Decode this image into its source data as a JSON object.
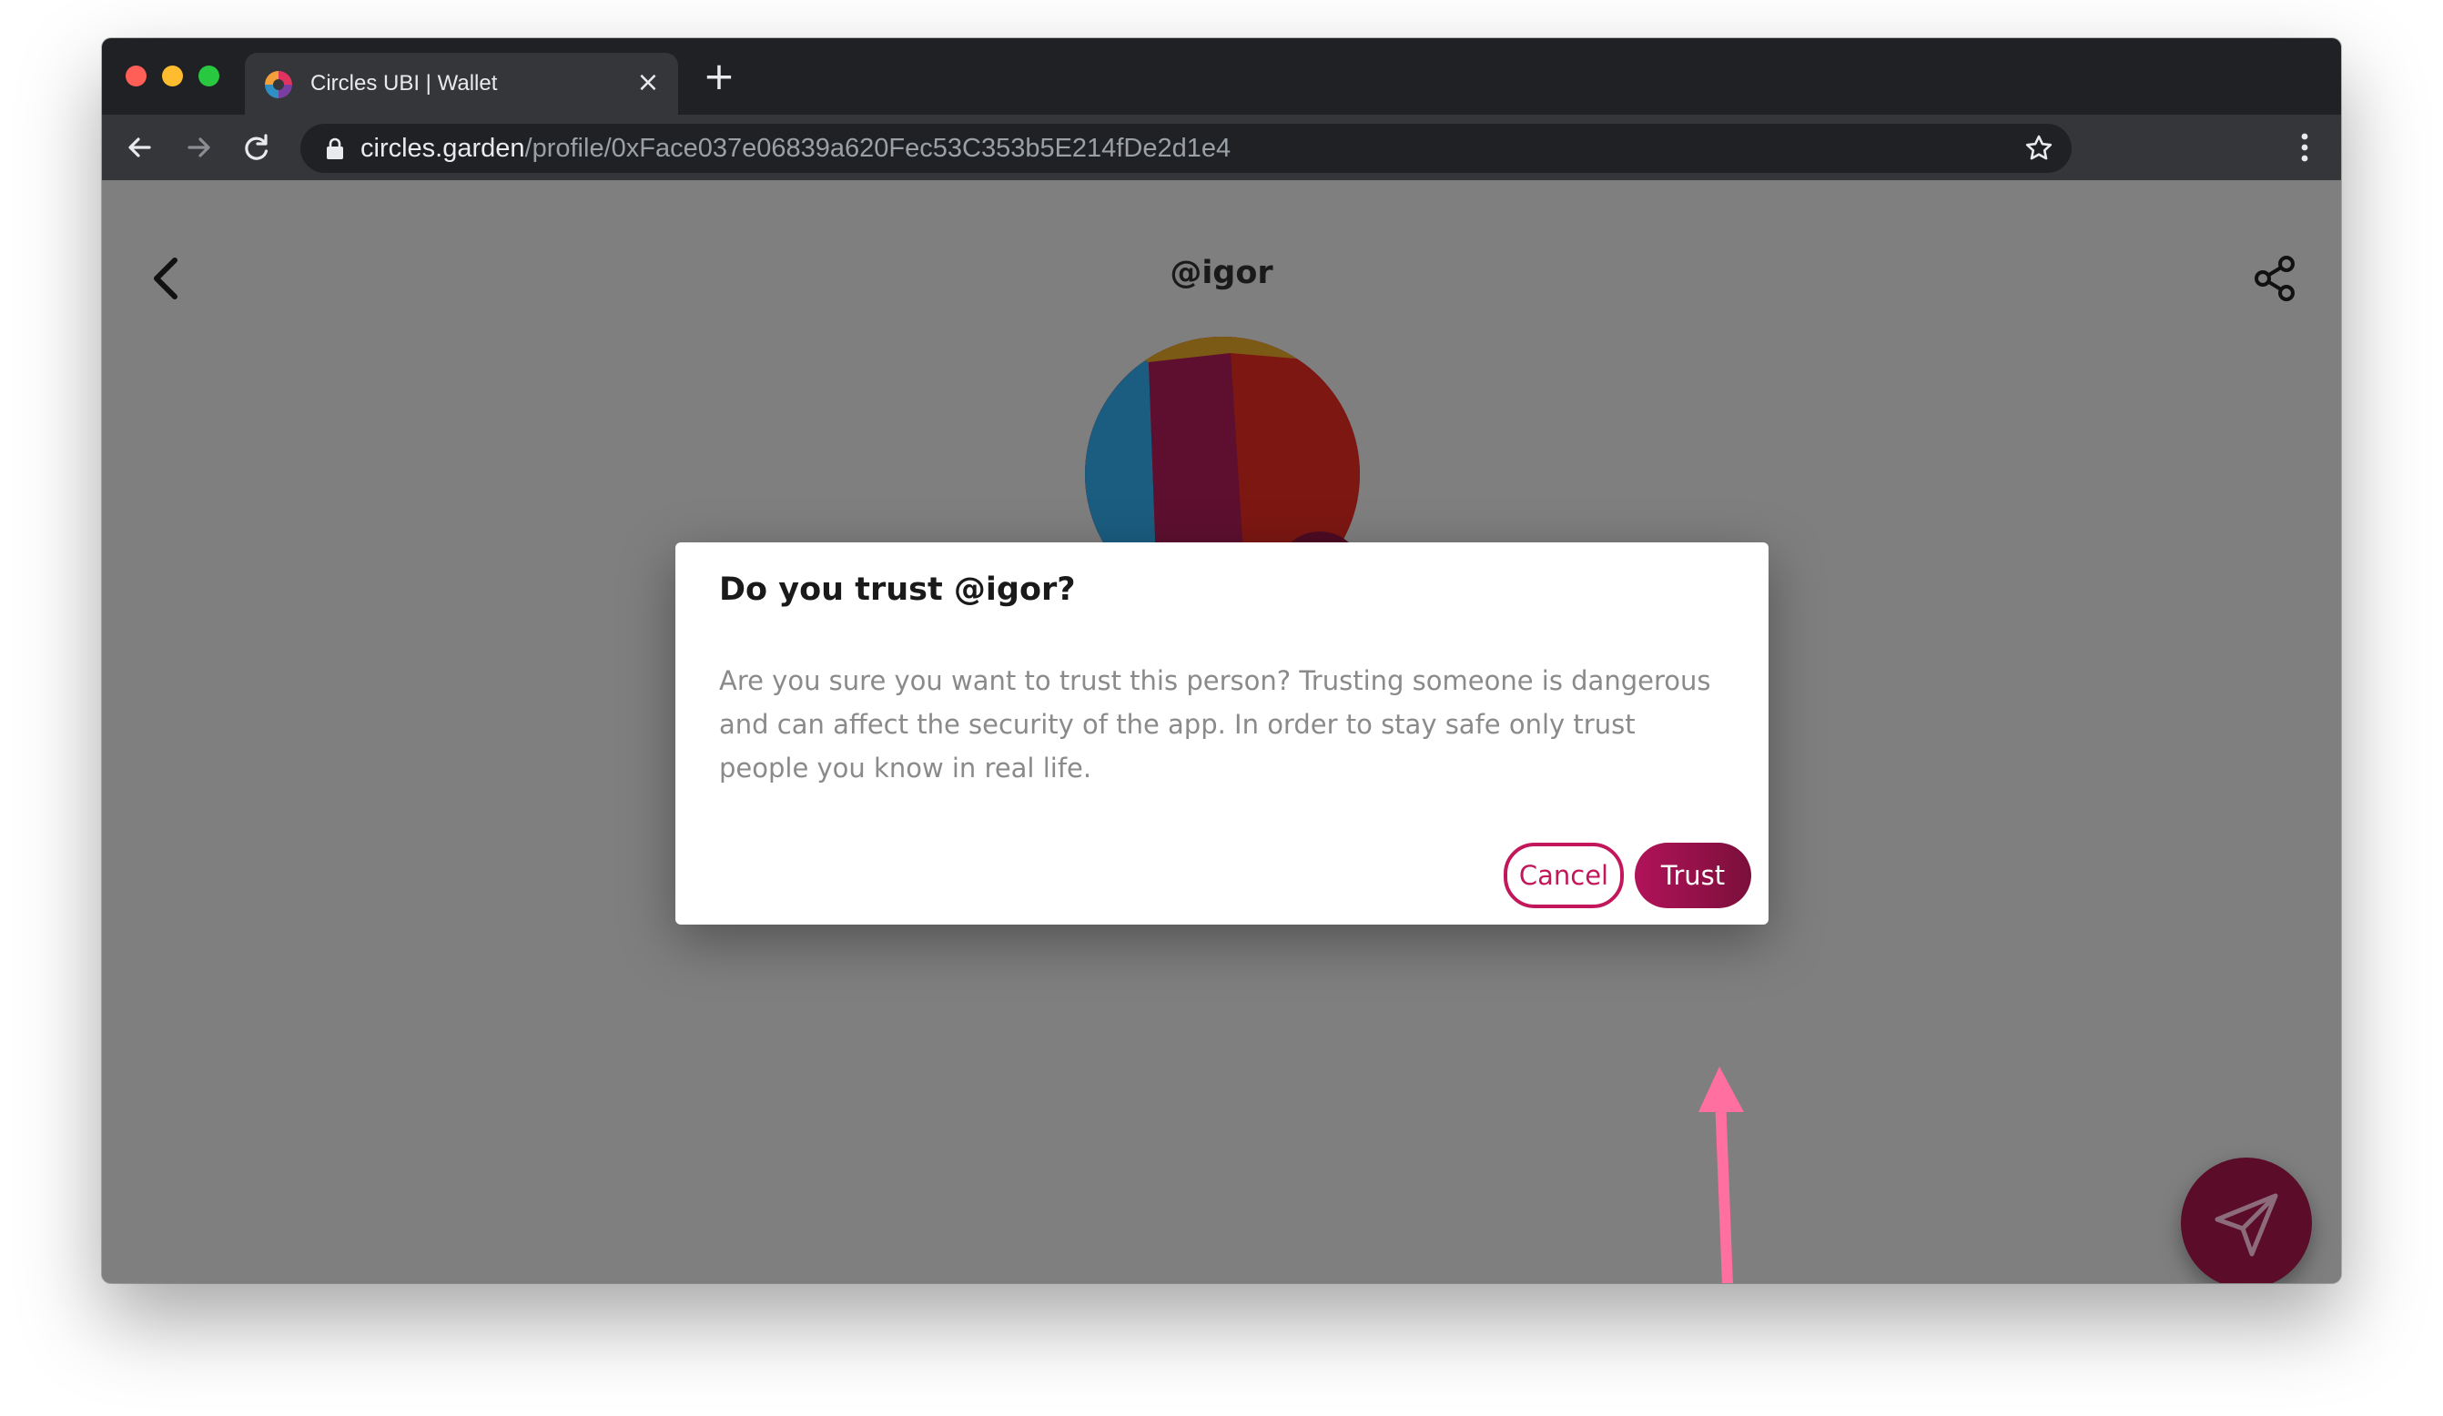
{
  "browser": {
    "tab": {
      "title": "Circles UBI | Wallet",
      "favicon": "circles-logo-icon"
    },
    "address": {
      "host": "circles.garden",
      "path": "/profile/0xFace037e06839a620Fec53C353b5E214fDe2d1e4"
    }
  },
  "page": {
    "title": "@igor",
    "avatar": {
      "colors": [
        "#1b5d80",
        "#5e0f30",
        "#7d1712",
        "#7a5a14"
      ]
    }
  },
  "dialog": {
    "title": "Do you trust @igor?",
    "body": "Are you sure you want to trust this person? Trusting someone is dangerous and can affect the security of the app. In order to stay safe only trust people you know in real life.",
    "cancel_label": "Cancel",
    "trust_label": "Trust"
  },
  "colors": {
    "accent": "#c2185b",
    "overlay": "#7f7f7f",
    "annotation_arrow": "#ff6fa0"
  }
}
